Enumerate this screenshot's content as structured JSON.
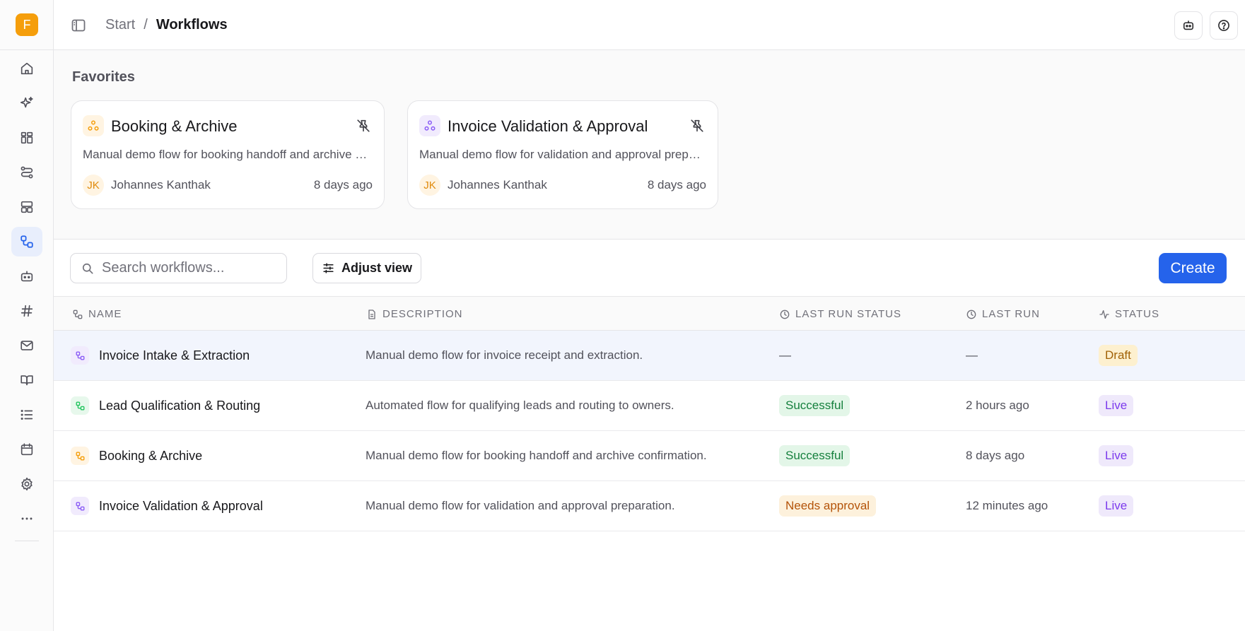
{
  "app": {
    "logo_letter": "F"
  },
  "sidebar": {
    "items": [
      {
        "icon": "home-icon"
      },
      {
        "icon": "sparkles-icon"
      },
      {
        "icon": "widgets-icon"
      },
      {
        "icon": "flow-icon"
      },
      {
        "icon": "layout-icon"
      },
      {
        "icon": "workflow-icon",
        "active": true
      },
      {
        "icon": "bot-icon"
      },
      {
        "icon": "hash-icon"
      },
      {
        "icon": "mail-icon"
      },
      {
        "icon": "book-icon"
      },
      {
        "icon": "list-icon"
      },
      {
        "icon": "calendar-icon"
      },
      {
        "icon": "settings-icon"
      },
      {
        "icon": "more-icon"
      }
    ]
  },
  "header": {
    "breadcrumb": {
      "start": "Start",
      "separator": "/",
      "current": "Workflows"
    }
  },
  "favorites": {
    "title": "Favorites",
    "cards": [
      {
        "name": "Booking & Archive",
        "description": "Manual demo flow for booking handoff and archive confirmation.",
        "initials": "JK",
        "owner": "Johannes Kanthak",
        "time": "8 days ago",
        "icon_color": "#f59e0b",
        "icon_bg": "#fff4e2"
      },
      {
        "name": "Invoice Validation & Approval",
        "description": "Manual demo flow for validation and approval preparation.",
        "initials": "JK",
        "owner": "Johannes Kanthak",
        "time": "8 days ago",
        "icon_color": "#8b5cf6",
        "icon_bg": "#f1ebfd"
      }
    ]
  },
  "toolbar": {
    "search_placeholder": "Search workflows...",
    "adjust_label": "Adjust view",
    "create_label": "Create"
  },
  "table": {
    "columns": {
      "name": "NAME",
      "description": "DESCRIPTION",
      "last_run_status": "LAST RUN STATUS",
      "last_run": "LAST RUN",
      "status": "STATUS"
    },
    "rows": [
      {
        "name": "Invoice Intake & Extraction",
        "description": "Manual demo flow for invoice receipt and extraction.",
        "last_run_status": "—",
        "last_run": "—",
        "status": "Draft",
        "icon_color": "#8b5cf6",
        "icon_bg": "#f1ebfd"
      },
      {
        "name": "Lead Qualification & Routing",
        "description": "Automated flow for qualifying leads and routing to owners.",
        "last_run_status": "Successful",
        "last_run": "2 hours ago",
        "status": "Live",
        "icon_color": "#22c55e",
        "icon_bg": "#e7f8ec"
      },
      {
        "name": "Booking & Archive",
        "description": "Manual demo flow for booking handoff and archive confirmation.",
        "last_run_status": "Successful",
        "last_run": "8 days ago",
        "status": "Live",
        "icon_color": "#f59e0b",
        "icon_bg": "#fff4e2"
      },
      {
        "name": "Invoice Validation & Approval",
        "description": "Manual demo flow for validation and approval preparation.",
        "last_run_status": "Needs approval",
        "last_run": "12 minutes ago",
        "status": "Live",
        "icon_color": "#8b5cf6",
        "icon_bg": "#f1ebfd"
      }
    ]
  },
  "colors": {
    "accent": "#2563eb",
    "logo": "#f59e0b"
  }
}
